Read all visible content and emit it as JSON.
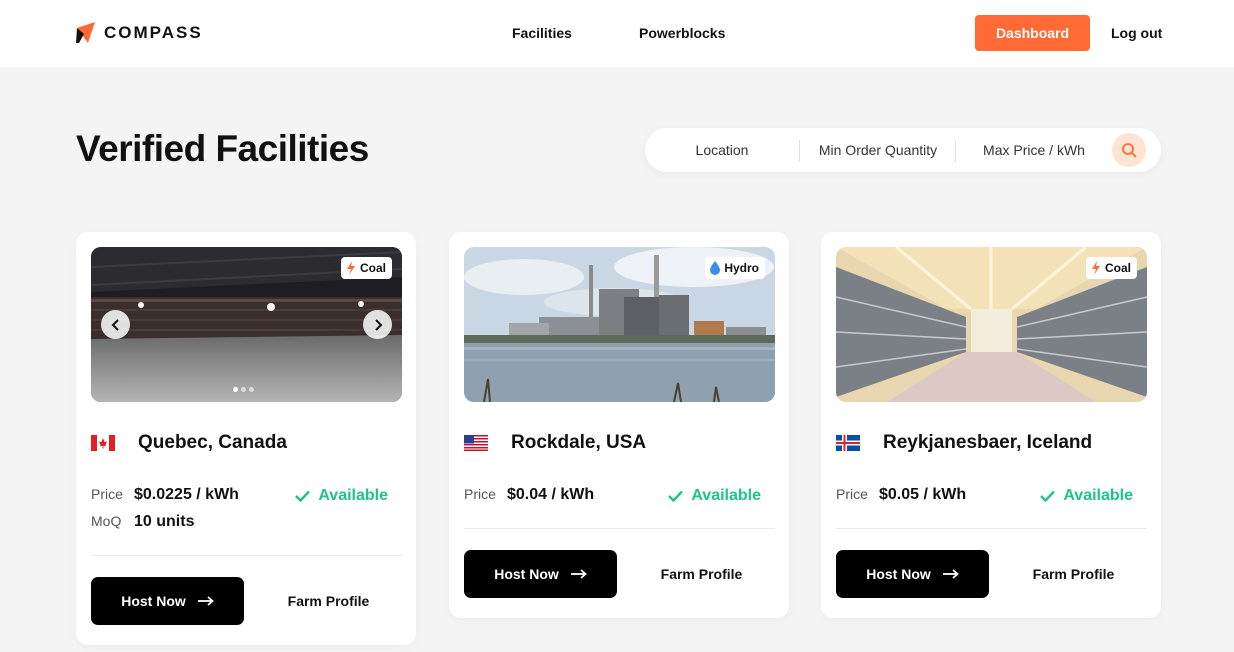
{
  "brand": {
    "name": "COMPASS"
  },
  "nav": {
    "facilities": "Facilities",
    "powerblocks": "Powerblocks"
  },
  "header": {
    "dashboard_label": "Dashboard",
    "logout_label": "Log out"
  },
  "page": {
    "title": "Verified Facilities"
  },
  "search": {
    "location": "Location",
    "min_order_quantity": "Min Order Quantity",
    "max_price": "Max Price / kWh"
  },
  "colors": {
    "accent": "#ff6a35",
    "available": "#1dc48a",
    "primary_button": "#000000"
  },
  "facilities": [
    {
      "location": "Quebec, Canada",
      "flag": "canada-flag-icon",
      "energy_type": "Coal",
      "energy_icon": "lightning-bolt-icon",
      "price_label": "Price",
      "price": "$0.0225 / kWh",
      "moq_label": "MoQ",
      "moq": "10 units",
      "status": "Available",
      "host_label": "Host Now",
      "profile_label": "Farm Profile"
    },
    {
      "location": "Rockdale, USA",
      "flag": "usa-flag-icon",
      "energy_type": "Hydro",
      "energy_icon": "water-drop-icon",
      "price_label": "Price",
      "price": "$0.04 / kWh",
      "status": "Available",
      "host_label": "Host Now",
      "profile_label": "Farm Profile"
    },
    {
      "location": "Reykjanesbaer, Iceland",
      "flag": "iceland-flag-icon",
      "energy_type": "Coal",
      "energy_icon": "lightning-bolt-icon",
      "price_label": "Price",
      "price": "$0.05 / kWh",
      "status": "Available",
      "host_label": "Host Now",
      "profile_label": "Farm Profile"
    }
  ]
}
